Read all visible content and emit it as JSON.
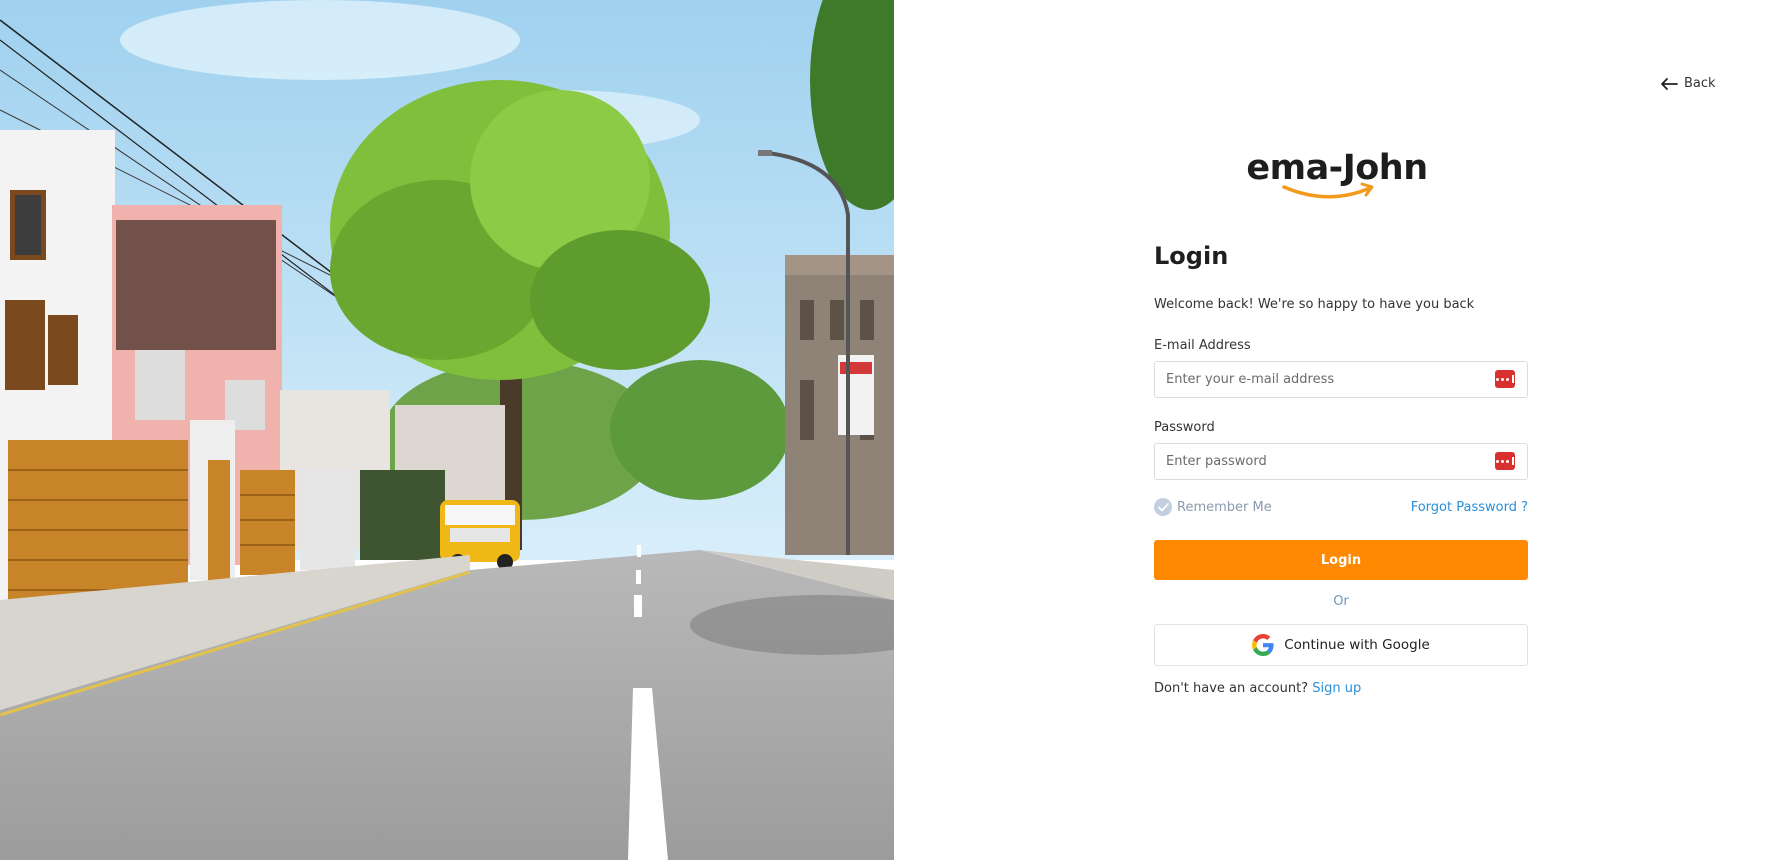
{
  "nav": {
    "back_label": "Back"
  },
  "logo": {
    "text": "ema-John"
  },
  "login": {
    "title": "Login",
    "welcome": "Welcome back! We're so happy to have you back",
    "email_label": "E-mail Address",
    "email_placeholder": "Enter your e-mail address",
    "password_label": "Password",
    "password_placeholder": "Enter password",
    "remember_label": "Remember Me",
    "forgot_label": "Forgot Password ?",
    "submit_label": "Login",
    "or_label": "Or",
    "google_label": "Continue with Google",
    "no_account_text": "Don't have an account?",
    "signup_label": "Sign up"
  },
  "icons": {
    "back": "arrow-left-icon",
    "password_manager": "password-manager-icon",
    "remember_check": "check-icon",
    "google": "google-logo-icon"
  },
  "colors": {
    "accent": "#ff8900",
    "link": "#2a8fd6",
    "password_manager": "#d92f2f",
    "remember_check": "#c2cfdf"
  }
}
